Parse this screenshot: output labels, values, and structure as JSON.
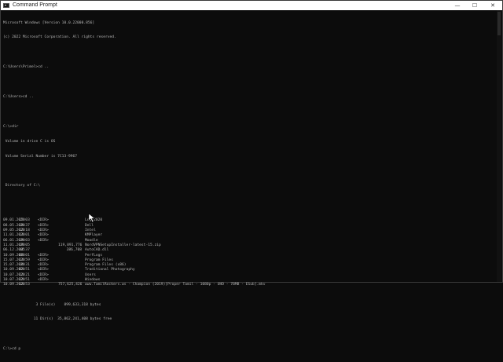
{
  "window": {
    "title": "Command Prompt",
    "controls": [
      "—",
      "☐",
      "✕"
    ]
  },
  "console": {
    "header": [
      "Microsoft Windows [Version 10.0.22000.856]",
      "(c) 2022 Microsoft Corporation. All rights reserved."
    ],
    "cmd1": "C:\\Users\\Primel>cd ..",
    "cmd2": "C:\\Users>cd ..",
    "cmd3": "C:\\>dir",
    "volume_line": " Volume in drive C is OS",
    "serial_line": " Volume Serial Number is 7C13-9967",
    "directory_of": " Directory of C:\\",
    "entries": [
      {
        "date": "09.01.2020",
        "time": "15:03",
        "type": "<DIR>",
        "size": "",
        "name": "Logs2020"
      },
      {
        "date": "08.05.2020",
        "time": "18:37",
        "type": "<DIR>",
        "size": "",
        "name": "Dell"
      },
      {
        "date": "09.05.2020",
        "time": "12:18",
        "type": "<DIR>",
        "size": "",
        "name": "Intel"
      },
      {
        "date": "11.01.2020",
        "time": "13:01",
        "type": "<DIR>",
        "size": "",
        "name": "KMPlayer"
      },
      {
        "date": "06.01.2020",
        "time": "19:03",
        "type": "<DIR>",
        "size": "",
        "name": "Moodle"
      },
      {
        "date": "11.01.2020",
        "time": "19:05",
        "type": "",
        "size": "119,891,776",
        "name": "NordVPNSetupInstaller-latest-15.zip"
      },
      {
        "date": "06.12.2005",
        "time": "14:37",
        "type": "",
        "size": "386,708",
        "name": "AutoCAD.dll"
      },
      {
        "date": "10.09.2020",
        "time": "00:01",
        "type": "<DIR>",
        "size": "",
        "name": "PerfLogs"
      },
      {
        "date": "15.07.2020",
        "time": "13:59",
        "type": "<DIR>",
        "size": "",
        "name": "Program Files"
      },
      {
        "date": "15.07.2020",
        "time": "10:31",
        "type": "<DIR>",
        "size": "",
        "name": "Program Files (x86)"
      },
      {
        "date": "10.09.2020",
        "time": "02:51",
        "type": "<DIR>",
        "size": "",
        "name": "Traditional Photography"
      },
      {
        "date": "10.07.2020",
        "time": "12:21",
        "type": "<DIR>",
        "size": "",
        "name": "Users"
      },
      {
        "date": "10.07.2020",
        "time": "12:51",
        "type": "<DIR>",
        "size": "",
        "name": "Windows"
      },
      {
        "date": "10.09.2020",
        "time": "12:53",
        "type": "",
        "size": "757,625,426",
        "name": "www.TamilRockers.ws - Champion (2019)[Proper Tamil - 1080p - UHD - 7BMB - ESub].mkv"
      }
    ],
    "files_summary": "               3 File(s)    899,633,318 bytes",
    "dirs_summary": "              11 Dir(s)  35,862,241,408 bytes free",
    "prompt": "C:\\>cd p"
  }
}
